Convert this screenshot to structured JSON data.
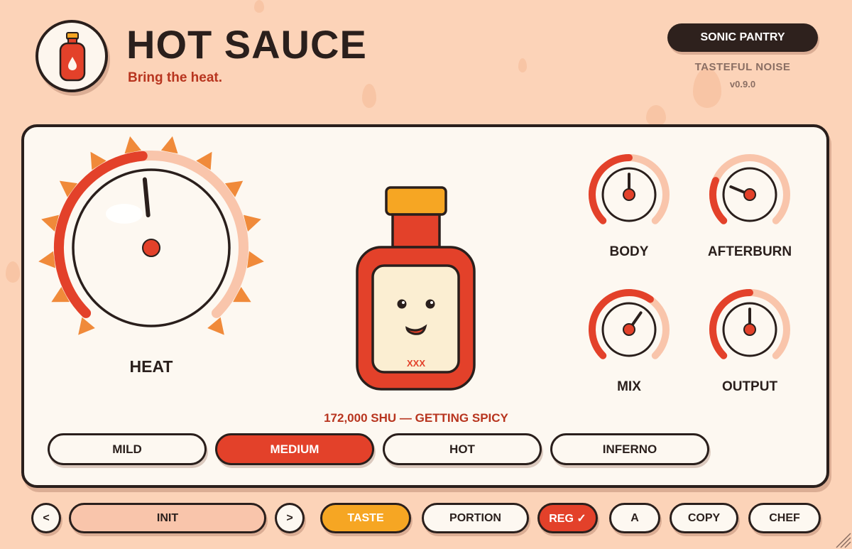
{
  "header": {
    "title": "HOT SAUCE",
    "tagline": "Bring the heat.",
    "brand_button": "SONIC PANTRY",
    "brand_subtitle": "TASTEFUL NOISE",
    "version": "v0.9.0"
  },
  "knobs": {
    "heat": {
      "label": "HEAT",
      "value": 0.48
    },
    "body": {
      "label": "BODY",
      "value": 0.5
    },
    "afterburn": {
      "label": "AFTERBURN",
      "value": 0.25
    },
    "mix": {
      "label": "MIX",
      "value": 0.63
    },
    "output": {
      "label": "OUTPUT",
      "value": 0.5
    }
  },
  "bottle": {
    "label": "XXX"
  },
  "heat_readout": "172,000 SHU — GETTING SPICY",
  "presets": [
    {
      "label": "MILD",
      "active": false
    },
    {
      "label": "MEDIUM",
      "active": true
    },
    {
      "label": "HOT",
      "active": false
    },
    {
      "label": "INFERNO",
      "active": false
    }
  ],
  "bottom_bar": {
    "prev": "<",
    "preset_name": "INIT",
    "next": ">",
    "taste": "TASTE",
    "portion": "PORTION",
    "reg": "REG ✓",
    "ab": "A",
    "copy": "COPY",
    "chef": "CHEF"
  },
  "colors": {
    "background": "#fcd3b8",
    "panel": "#fdf8f1",
    "accent_red": "#e3412a",
    "accent_light": "#f9c5ab",
    "accent_orange": "#f6a623",
    "ink": "#2a1f1c",
    "tagline_red": "#b8351f"
  }
}
